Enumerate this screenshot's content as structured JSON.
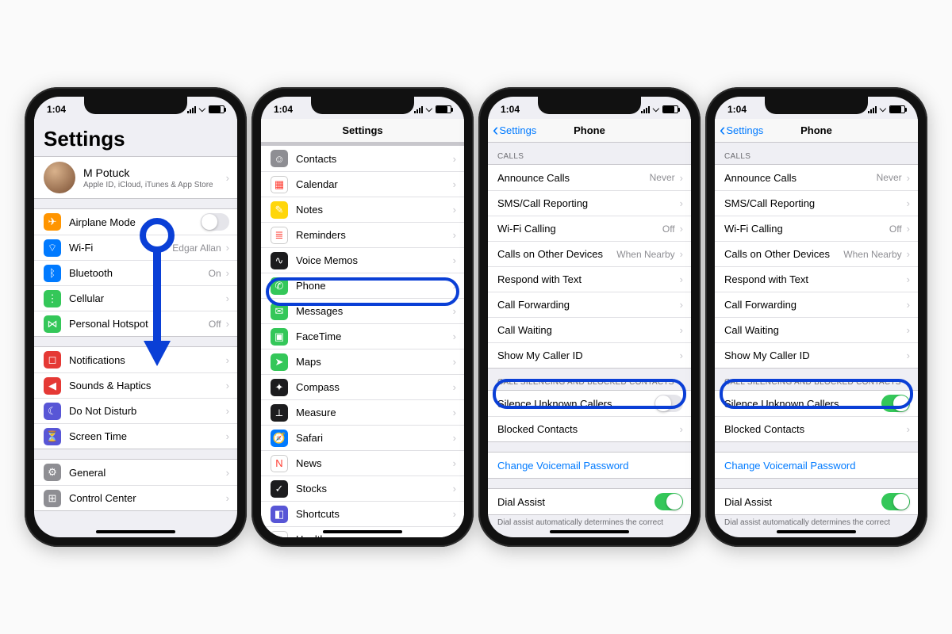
{
  "status": {
    "time": "1:04"
  },
  "phone1": {
    "title": "Settings",
    "user": {
      "name": "M Potuck",
      "sub": "Apple ID, iCloud, iTunes & App Store"
    },
    "g1": [
      {
        "k": "airplane",
        "label": "Airplane Mode",
        "icon_bg": "ic-orange",
        "glyph": "✈︎",
        "toggle": false
      },
      {
        "k": "wifi",
        "label": "Wi-Fi",
        "value": "Edgar Allan",
        "icon_bg": "ic-blue",
        "glyph": "⌔"
      },
      {
        "k": "bluetooth",
        "label": "Bluetooth",
        "value": "On",
        "icon_bg": "ic-blue",
        "glyph": "ᛒ"
      },
      {
        "k": "cellular",
        "label": "Cellular",
        "icon_bg": "ic-green",
        "glyph": "⋮"
      },
      {
        "k": "hotspot",
        "label": "Personal Hotspot",
        "value": "Off",
        "icon_bg": "ic-green",
        "glyph": "⋈"
      }
    ],
    "g2": [
      {
        "k": "notifications",
        "label": "Notifications",
        "icon_bg": "ic-dred",
        "glyph": "◻︎"
      },
      {
        "k": "sounds",
        "label": "Sounds & Haptics",
        "icon_bg": "ic-dred",
        "glyph": "◀︎"
      },
      {
        "k": "dnd",
        "label": "Do Not Disturb",
        "icon_bg": "ic-indigo",
        "glyph": "☾"
      },
      {
        "k": "screentime",
        "label": "Screen Time",
        "icon_bg": "ic-indigo",
        "glyph": "⏳"
      }
    ],
    "g3": [
      {
        "k": "general",
        "label": "General",
        "icon_bg": "ic-grey",
        "glyph": "⚙︎"
      },
      {
        "k": "controlcenter",
        "label": "Control Center",
        "icon_bg": "ic-grey",
        "glyph": "⊞"
      }
    ]
  },
  "phone2": {
    "title": "Settings",
    "items": [
      {
        "k": "contacts",
        "label": "Contacts",
        "icon_bg": "ic-grey",
        "glyph": "☺︎"
      },
      {
        "k": "calendar",
        "label": "Calendar",
        "icon_bg": "ic-white",
        "glyph": "▦"
      },
      {
        "k": "notes",
        "label": "Notes",
        "icon_bg": "ic-yellow",
        "glyph": "✎"
      },
      {
        "k": "reminders",
        "label": "Reminders",
        "icon_bg": "ic-white",
        "glyph": "≣"
      },
      {
        "k": "voicememos",
        "label": "Voice Memos",
        "icon_bg": "ic-black",
        "glyph": "∿"
      },
      {
        "k": "phone",
        "label": "Phone",
        "icon_bg": "ic-green",
        "glyph": "✆"
      },
      {
        "k": "messages",
        "label": "Messages",
        "icon_bg": "ic-green",
        "glyph": "✉︎"
      },
      {
        "k": "facetime",
        "label": "FaceTime",
        "icon_bg": "ic-green",
        "glyph": "▣"
      },
      {
        "k": "maps",
        "label": "Maps",
        "icon_bg": "ic-green",
        "glyph": "➤"
      },
      {
        "k": "compass",
        "label": "Compass",
        "icon_bg": "ic-black",
        "glyph": "✦"
      },
      {
        "k": "measure",
        "label": "Measure",
        "icon_bg": "ic-black",
        "glyph": "⟂"
      },
      {
        "k": "safari",
        "label": "Safari",
        "icon_bg": "ic-blue",
        "glyph": "🧭"
      },
      {
        "k": "news",
        "label": "News",
        "icon_bg": "ic-white",
        "glyph": "N"
      },
      {
        "k": "stocks",
        "label": "Stocks",
        "icon_bg": "ic-black",
        "glyph": "✓"
      },
      {
        "k": "shortcuts",
        "label": "Shortcuts",
        "icon_bg": "ic-indigo",
        "glyph": "◧"
      },
      {
        "k": "health",
        "label": "Health",
        "icon_bg": "ic-white",
        "glyph": "♥︎"
      }
    ]
  },
  "phone_settings": {
    "back": "Settings",
    "title": "Phone",
    "sec1_header": "CALLS",
    "sec1": [
      {
        "k": "announce",
        "label": "Announce Calls",
        "value": "Never"
      },
      {
        "k": "smscall",
        "label": "SMS/Call Reporting"
      },
      {
        "k": "wificalling",
        "label": "Wi-Fi Calling",
        "value": "Off"
      },
      {
        "k": "otherdevices",
        "label": "Calls on Other Devices",
        "value": "When Nearby"
      },
      {
        "k": "respondtext",
        "label": "Respond with Text"
      },
      {
        "k": "callfwd",
        "label": "Call Forwarding"
      },
      {
        "k": "callwait",
        "label": "Call Waiting"
      },
      {
        "k": "callerid",
        "label": "Show My Caller ID"
      }
    ],
    "sec2_header": "CALL SILENCING AND BLOCKED CONTACTS",
    "silence_label": "Silence Unknown Callers",
    "blocked_label": "Blocked Contacts",
    "voicemail_label": "Change Voicemail Password",
    "dialassist_label": "Dial Assist",
    "dialassist_footer": "Dial assist automatically determines the correct"
  },
  "phone3": {
    "silence_on": false
  },
  "phone4": {
    "silence_on": true
  }
}
